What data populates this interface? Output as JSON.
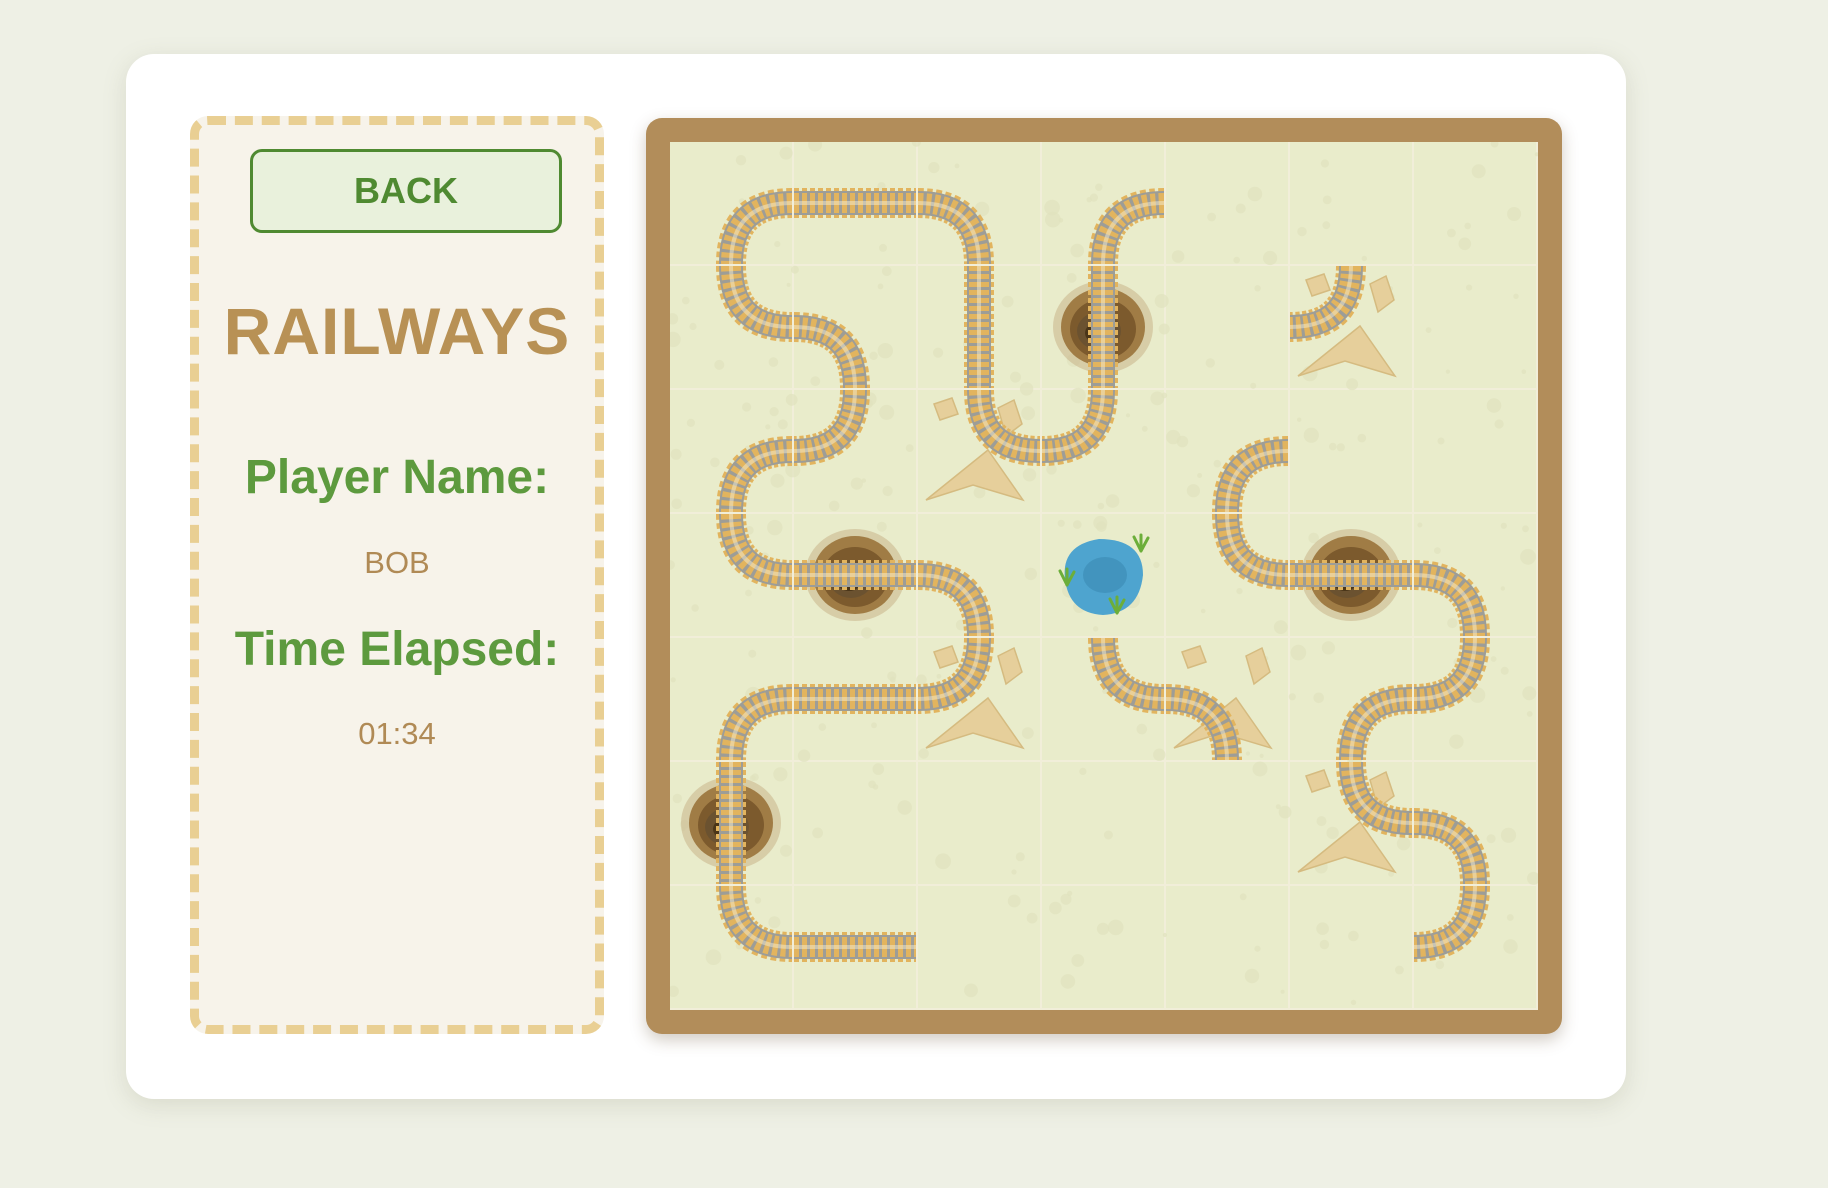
{
  "sidebar": {
    "back_label": "BACK",
    "title": "RAILWAYS",
    "player_label": "Player Name:",
    "player_name": "BOB",
    "time_label": "Time Elapsed:",
    "time_value": "01:34"
  },
  "board": {
    "rows": 7,
    "cols": 7,
    "colors": {
      "frame": "#b28d5a",
      "tile": "#e9eccb",
      "sleeper": "#e2b45e",
      "rail": "#9d9d97",
      "mountain": "#6b5230",
      "lake": "#4ea4cf"
    },
    "oases": [
      {
        "row": 3,
        "col": 3
      }
    ],
    "mountains": [
      {
        "row": 1,
        "col": 3
      },
      {
        "row": 3,
        "col": 1
      },
      {
        "row": 3,
        "col": 5
      },
      {
        "row": 5,
        "col": 0
      }
    ],
    "rocks": [
      {
        "row": 1,
        "col": 5
      },
      {
        "row": 2,
        "col": 2
      },
      {
        "row": 4,
        "col": 2
      },
      {
        "row": 4,
        "col": 4
      },
      {
        "row": 5,
        "col": 5
      }
    ],
    "tracks": [
      {
        "row": 0,
        "col": 0,
        "type": "corner",
        "sides": [
          "right",
          "bottom"
        ]
      },
      {
        "row": 0,
        "col": 1,
        "type": "straight",
        "sides": [
          "left",
          "right"
        ]
      },
      {
        "row": 0,
        "col": 2,
        "type": "corner",
        "sides": [
          "left",
          "bottom"
        ]
      },
      {
        "row": 0,
        "col": 3,
        "type": "corner",
        "sides": [
          "right",
          "bottom"
        ]
      },
      {
        "row": 1,
        "col": 0,
        "type": "corner",
        "sides": [
          "top",
          "right"
        ]
      },
      {
        "row": 1,
        "col": 1,
        "type": "corner",
        "sides": [
          "left",
          "bottom"
        ]
      },
      {
        "row": 1,
        "col": 2,
        "type": "straight",
        "sides": [
          "top",
          "bottom"
        ]
      },
      {
        "row": 1,
        "col": 3,
        "type": "straight",
        "sides": [
          "top",
          "bottom"
        ]
      },
      {
        "row": 1,
        "col": 5,
        "type": "corner",
        "sides": [
          "top",
          "left"
        ]
      },
      {
        "row": 2,
        "col": 0,
        "type": "corner",
        "sides": [
          "right",
          "bottom"
        ]
      },
      {
        "row": 2,
        "col": 1,
        "type": "corner",
        "sides": [
          "top",
          "left"
        ]
      },
      {
        "row": 2,
        "col": 2,
        "type": "corner",
        "sides": [
          "top",
          "right"
        ]
      },
      {
        "row": 2,
        "col": 3,
        "type": "corner",
        "sides": [
          "top",
          "left"
        ]
      },
      {
        "row": 2,
        "col": 4,
        "type": "corner",
        "sides": [
          "right",
          "bottom"
        ]
      },
      {
        "row": 3,
        "col": 0,
        "type": "corner",
        "sides": [
          "top",
          "right"
        ]
      },
      {
        "row": 3,
        "col": 1,
        "type": "straight",
        "sides": [
          "left",
          "right"
        ]
      },
      {
        "row": 3,
        "col": 2,
        "type": "corner",
        "sides": [
          "left",
          "bottom"
        ]
      },
      {
        "row": 3,
        "col": 4,
        "type": "corner",
        "sides": [
          "top",
          "right"
        ]
      },
      {
        "row": 3,
        "col": 5,
        "type": "straight",
        "sides": [
          "left",
          "right"
        ]
      },
      {
        "row": 3,
        "col": 6,
        "type": "corner",
        "sides": [
          "left",
          "bottom"
        ]
      },
      {
        "row": 4,
        "col": 0,
        "type": "corner",
        "sides": [
          "right",
          "bottom"
        ]
      },
      {
        "row": 4,
        "col": 1,
        "type": "straight",
        "sides": [
          "left",
          "right"
        ]
      },
      {
        "row": 4,
        "col": 2,
        "type": "corner",
        "sides": [
          "top",
          "left"
        ]
      },
      {
        "row": 4,
        "col": 3,
        "type": "corner",
        "sides": [
          "top",
          "right"
        ]
      },
      {
        "row": 4,
        "col": 4,
        "type": "corner",
        "sides": [
          "left",
          "bottom"
        ]
      },
      {
        "row": 4,
        "col": 5,
        "type": "corner",
        "sides": [
          "right",
          "bottom"
        ]
      },
      {
        "row": 4,
        "col": 6,
        "type": "corner",
        "sides": [
          "top",
          "left"
        ]
      },
      {
        "row": 5,
        "col": 0,
        "type": "straight",
        "sides": [
          "top",
          "bottom"
        ]
      },
      {
        "row": 5,
        "col": 5,
        "type": "corner",
        "sides": [
          "top",
          "right"
        ]
      },
      {
        "row": 5,
        "col": 6,
        "type": "corner",
        "sides": [
          "left",
          "bottom"
        ]
      },
      {
        "row": 6,
        "col": 0,
        "type": "corner",
        "sides": [
          "top",
          "right"
        ]
      },
      {
        "row": 6,
        "col": 1,
        "type": "straight",
        "sides": [
          "left",
          "right"
        ]
      },
      {
        "row": 6,
        "col": 6,
        "type": "corner",
        "sides": [
          "top",
          "left"
        ]
      }
    ]
  }
}
